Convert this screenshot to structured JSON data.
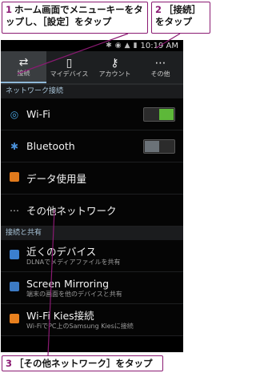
{
  "callouts": {
    "step1": {
      "num": "1",
      "text": "ホーム画面でメニューキーをタップし、［設定］をタップ"
    },
    "step2": {
      "num": "2",
      "text": "［接続］をタップ"
    },
    "step3": {
      "num": "3",
      "text": "［その他ネットワーク］をタップ"
    }
  },
  "status_bar": {
    "time": "10:19 AM"
  },
  "tabs": [
    {
      "label": "接続",
      "icon": "connection-icon",
      "active": true
    },
    {
      "label": "マイデバイス",
      "icon": "device-icon",
      "active": false
    },
    {
      "label": "アカウント",
      "icon": "key-icon",
      "active": false
    },
    {
      "label": "その他",
      "icon": "more-icon",
      "active": false
    }
  ],
  "sections": {
    "network": "ネットワーク接続",
    "share": "接続と共有"
  },
  "rows": {
    "wifi": {
      "label": "Wi-Fi",
      "toggle": "on"
    },
    "bluetooth": {
      "label": "Bluetooth",
      "toggle": "off"
    },
    "data_usage": {
      "label": "データ使用量"
    },
    "other_network": {
      "label": "その他ネットワーク"
    },
    "nearby": {
      "label": "近くのデバイス",
      "sub": "DLNAでメディアファイルを共有"
    },
    "mirroring": {
      "label": "Screen Mirroring",
      "sub": "端末の画面を他のデバイスと共有"
    },
    "kies": {
      "label": "Wi-Fi Kies接続",
      "sub": "Wi-FiでPC上のSamsung Kiesに接続"
    }
  },
  "colors": {
    "accent": "#8a1a72",
    "toggle_on": "#5db839",
    "section_text": "#a8c4d8"
  }
}
